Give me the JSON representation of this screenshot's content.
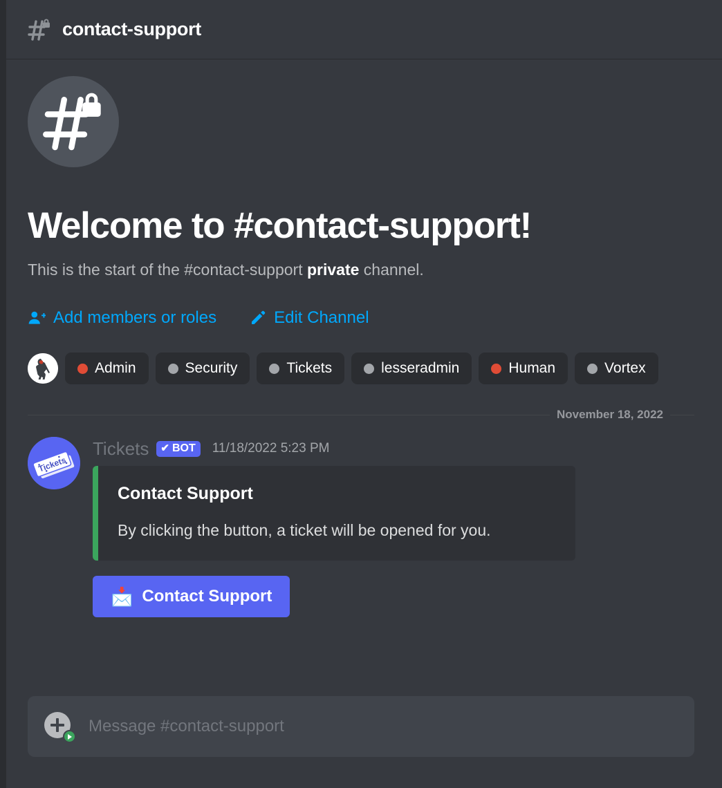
{
  "header": {
    "channel_name": "contact-support",
    "channel_icon": "hash-lock-icon"
  },
  "welcome": {
    "icon": "hash-lock-icon",
    "title": "Welcome to #contact-support!",
    "subtitle_prefix": "This is the start of the #contact-support ",
    "subtitle_bold": "private",
    "subtitle_suffix": " channel."
  },
  "actions": [
    {
      "label": "Add members or roles",
      "icon": "add-member-icon"
    },
    {
      "label": "Edit Channel",
      "icon": "pencil-icon"
    }
  ],
  "roles": {
    "avatar": "user-avatar",
    "items": [
      {
        "label": "Admin",
        "color": "#e04c36"
      },
      {
        "label": "Security",
        "color": "#a3a6aa"
      },
      {
        "label": "Tickets",
        "color": "#a3a6aa"
      },
      {
        "label": "lesseradmin",
        "color": "#a3a6aa"
      },
      {
        "label": "Human",
        "color": "#e04c36"
      },
      {
        "label": "Vortex",
        "color": "#a3a6aa"
      }
    ]
  },
  "divider": {
    "date": "November 18, 2022"
  },
  "message": {
    "avatar": "tickets-bot-avatar",
    "author": "Tickets",
    "badge": "BOT",
    "badge_check": "✔",
    "timestamp": "11/18/2022 5:23 PM",
    "embed": {
      "accent_color": "#3ba55d",
      "title": "Contact Support",
      "description": "By clicking the button, a ticket will be opened for you."
    },
    "button": {
      "emoji": "📩",
      "label": "Contact Support",
      "color": "#5865f2"
    }
  },
  "composer": {
    "placeholder": "Message #contact-support",
    "value": "",
    "attach_icon": "add-attachment-icon"
  },
  "colors": {
    "background": "#36393f",
    "header": "#36393f",
    "embed_bg": "#2f3136",
    "link": "#00a8fc",
    "blurple": "#5865f2",
    "green": "#3ba55d"
  }
}
